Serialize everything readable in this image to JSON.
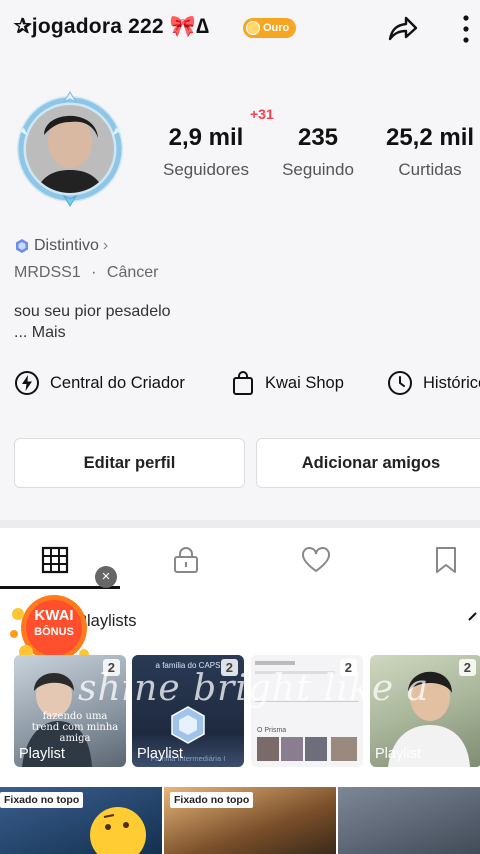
{
  "header": {
    "username": "✰jogadora 222 🎀∆",
    "level_badge": "Ouro"
  },
  "stats": {
    "followers_delta": "+31",
    "items": [
      {
        "value": "2,9 mil",
        "label": "Seguidores"
      },
      {
        "value": "235",
        "label": "Seguindo"
      },
      {
        "value": "25,2 mil",
        "label": "Curtidas"
      }
    ]
  },
  "profile": {
    "badge_label": "Distintivo",
    "meta_id": "MRDSS1",
    "meta_sep": "·",
    "meta_sign": "Câncer",
    "bio": "sou seu pior pesadelo",
    "more": "...  Mais"
  },
  "tools": [
    {
      "label": "Central do Criador",
      "icon": "bolt-icon"
    },
    {
      "label": "Kwai Shop",
      "icon": "bag-icon"
    },
    {
      "label": "Histórico",
      "icon": "clock-icon"
    }
  ],
  "buttons": {
    "edit": "Editar perfil",
    "add_friends": "Adicionar amigos"
  },
  "tabs": [
    "grid-icon",
    "lock-icon",
    "heart-icon",
    "bookmark-icon"
  ],
  "kwai_bonus": {
    "line1": "KWAI",
    "line2": "BÔNUS"
  },
  "playlists": {
    "title": "Playlists",
    "overlay": "shine bright like a",
    "cards": [
      {
        "count": "2",
        "label": "Playlist",
        "caption": "fazendo uma trend com minha amiga"
      },
      {
        "count": "2",
        "label": "Playlist",
        "caption": "a familia do CAPS",
        "caption2": "Família Intermediária I"
      },
      {
        "count": "2",
        "label": "",
        "caption": "O Prisma"
      },
      {
        "count": "2",
        "label": "Playlist",
        "caption": ""
      }
    ]
  },
  "pinned": {
    "tag": "Fixado no topo"
  },
  "colors": {
    "accent_red": "#ff3b4e",
    "gold": "#f5a623"
  }
}
